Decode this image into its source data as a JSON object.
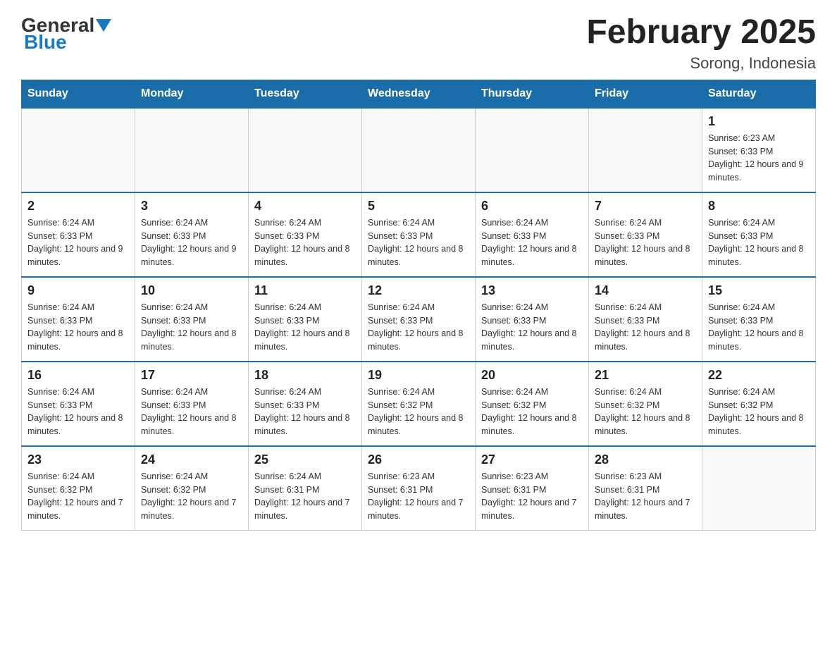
{
  "logo": {
    "general": "General",
    "blue": "Blue"
  },
  "title": "February 2025",
  "subtitle": "Sorong, Indonesia",
  "days_of_week": [
    "Sunday",
    "Monday",
    "Tuesday",
    "Wednesday",
    "Thursday",
    "Friday",
    "Saturday"
  ],
  "weeks": [
    [
      {
        "day": "",
        "info": ""
      },
      {
        "day": "",
        "info": ""
      },
      {
        "day": "",
        "info": ""
      },
      {
        "day": "",
        "info": ""
      },
      {
        "day": "",
        "info": ""
      },
      {
        "day": "",
        "info": ""
      },
      {
        "day": "1",
        "info": "Sunrise: 6:23 AM\nSunset: 6:33 PM\nDaylight: 12 hours and 9 minutes."
      }
    ],
    [
      {
        "day": "2",
        "info": "Sunrise: 6:24 AM\nSunset: 6:33 PM\nDaylight: 12 hours and 9 minutes."
      },
      {
        "day": "3",
        "info": "Sunrise: 6:24 AM\nSunset: 6:33 PM\nDaylight: 12 hours and 9 minutes."
      },
      {
        "day": "4",
        "info": "Sunrise: 6:24 AM\nSunset: 6:33 PM\nDaylight: 12 hours and 8 minutes."
      },
      {
        "day": "5",
        "info": "Sunrise: 6:24 AM\nSunset: 6:33 PM\nDaylight: 12 hours and 8 minutes."
      },
      {
        "day": "6",
        "info": "Sunrise: 6:24 AM\nSunset: 6:33 PM\nDaylight: 12 hours and 8 minutes."
      },
      {
        "day": "7",
        "info": "Sunrise: 6:24 AM\nSunset: 6:33 PM\nDaylight: 12 hours and 8 minutes."
      },
      {
        "day": "8",
        "info": "Sunrise: 6:24 AM\nSunset: 6:33 PM\nDaylight: 12 hours and 8 minutes."
      }
    ],
    [
      {
        "day": "9",
        "info": "Sunrise: 6:24 AM\nSunset: 6:33 PM\nDaylight: 12 hours and 8 minutes."
      },
      {
        "day": "10",
        "info": "Sunrise: 6:24 AM\nSunset: 6:33 PM\nDaylight: 12 hours and 8 minutes."
      },
      {
        "day": "11",
        "info": "Sunrise: 6:24 AM\nSunset: 6:33 PM\nDaylight: 12 hours and 8 minutes."
      },
      {
        "day": "12",
        "info": "Sunrise: 6:24 AM\nSunset: 6:33 PM\nDaylight: 12 hours and 8 minutes."
      },
      {
        "day": "13",
        "info": "Sunrise: 6:24 AM\nSunset: 6:33 PM\nDaylight: 12 hours and 8 minutes."
      },
      {
        "day": "14",
        "info": "Sunrise: 6:24 AM\nSunset: 6:33 PM\nDaylight: 12 hours and 8 minutes."
      },
      {
        "day": "15",
        "info": "Sunrise: 6:24 AM\nSunset: 6:33 PM\nDaylight: 12 hours and 8 minutes."
      }
    ],
    [
      {
        "day": "16",
        "info": "Sunrise: 6:24 AM\nSunset: 6:33 PM\nDaylight: 12 hours and 8 minutes."
      },
      {
        "day": "17",
        "info": "Sunrise: 6:24 AM\nSunset: 6:33 PM\nDaylight: 12 hours and 8 minutes."
      },
      {
        "day": "18",
        "info": "Sunrise: 6:24 AM\nSunset: 6:33 PM\nDaylight: 12 hours and 8 minutes."
      },
      {
        "day": "19",
        "info": "Sunrise: 6:24 AM\nSunset: 6:32 PM\nDaylight: 12 hours and 8 minutes."
      },
      {
        "day": "20",
        "info": "Sunrise: 6:24 AM\nSunset: 6:32 PM\nDaylight: 12 hours and 8 minutes."
      },
      {
        "day": "21",
        "info": "Sunrise: 6:24 AM\nSunset: 6:32 PM\nDaylight: 12 hours and 8 minutes."
      },
      {
        "day": "22",
        "info": "Sunrise: 6:24 AM\nSunset: 6:32 PM\nDaylight: 12 hours and 8 minutes."
      }
    ],
    [
      {
        "day": "23",
        "info": "Sunrise: 6:24 AM\nSunset: 6:32 PM\nDaylight: 12 hours and 7 minutes."
      },
      {
        "day": "24",
        "info": "Sunrise: 6:24 AM\nSunset: 6:32 PM\nDaylight: 12 hours and 7 minutes."
      },
      {
        "day": "25",
        "info": "Sunrise: 6:24 AM\nSunset: 6:31 PM\nDaylight: 12 hours and 7 minutes."
      },
      {
        "day": "26",
        "info": "Sunrise: 6:23 AM\nSunset: 6:31 PM\nDaylight: 12 hours and 7 minutes."
      },
      {
        "day": "27",
        "info": "Sunrise: 6:23 AM\nSunset: 6:31 PM\nDaylight: 12 hours and 7 minutes."
      },
      {
        "day": "28",
        "info": "Sunrise: 6:23 AM\nSunset: 6:31 PM\nDaylight: 12 hours and 7 minutes."
      },
      {
        "day": "",
        "info": ""
      }
    ]
  ]
}
